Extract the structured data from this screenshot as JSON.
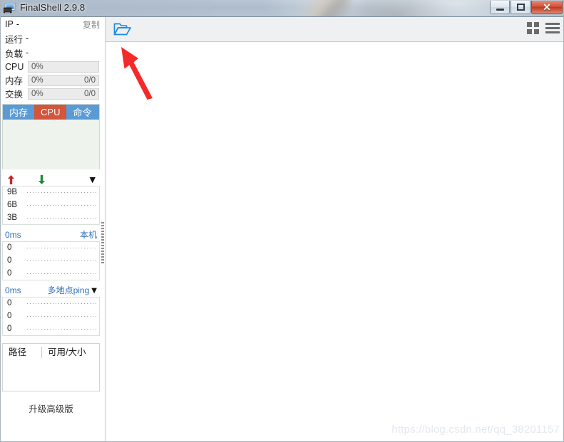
{
  "window": {
    "title": "FinalShell 2.9.8",
    "app_icon": "monitor-icon",
    "minimize_label": "–",
    "maximize_label": "□",
    "close_label": "✕"
  },
  "sidebar": {
    "info_rows": [
      {
        "label": "IP",
        "value": "-",
        "action": "复制"
      },
      {
        "label": "运行",
        "value": "-"
      },
      {
        "label": "负载",
        "value": "-"
      }
    ],
    "meters": [
      {
        "label": "CPU",
        "percent_text": "0%",
        "percent": 0,
        "detail": ""
      },
      {
        "label": "内存",
        "percent_text": "0%",
        "percent": 0,
        "detail": "0/0"
      },
      {
        "label": "交换",
        "percent_text": "0%",
        "percent": 0,
        "detail": "0/0"
      }
    ],
    "process_tabs": [
      {
        "label": "内存",
        "active": false
      },
      {
        "label": "CPU",
        "active": true
      },
      {
        "label": "命令",
        "active": false
      }
    ],
    "network_graph": {
      "upload_icon": "arrow-up-icon",
      "download_icon": "arrow-down-icon",
      "dropdown_icon": "chevron-down-icon",
      "yticks": [
        "9B",
        "6B",
        "3B"
      ]
    },
    "ping_local": {
      "value": "0ms",
      "title": "本机",
      "yticks": [
        "0",
        "0",
        "0"
      ]
    },
    "ping_multi": {
      "value": "0ms",
      "title": "多地点ping",
      "dropdown_icon": "chevron-down-icon",
      "yticks": [
        "0",
        "0",
        "0"
      ]
    },
    "disk_table": {
      "columns": [
        "路径",
        "可用/大小"
      ],
      "rows": []
    },
    "upgrade_label": "升级高级版"
  },
  "toolbar": {
    "folder_icon": "open-folder-icon",
    "grid_view_icon": "grid-view-icon",
    "list_view_icon": "list-view-icon"
  },
  "annotation": {
    "arrow_icon": "red-arrow-annotation"
  },
  "watermark": {
    "text": "https://blog.csdn.net/qq_38201157"
  },
  "colors": {
    "tab_blue": "#5b9bd5",
    "tab_active_orange": "#d2553c",
    "link_blue": "#2f6fb5",
    "upload_red": "#c1272d",
    "download_green": "#1e8a3c",
    "close_red": "#d4523a",
    "annotation_red": "#f42a2a"
  }
}
